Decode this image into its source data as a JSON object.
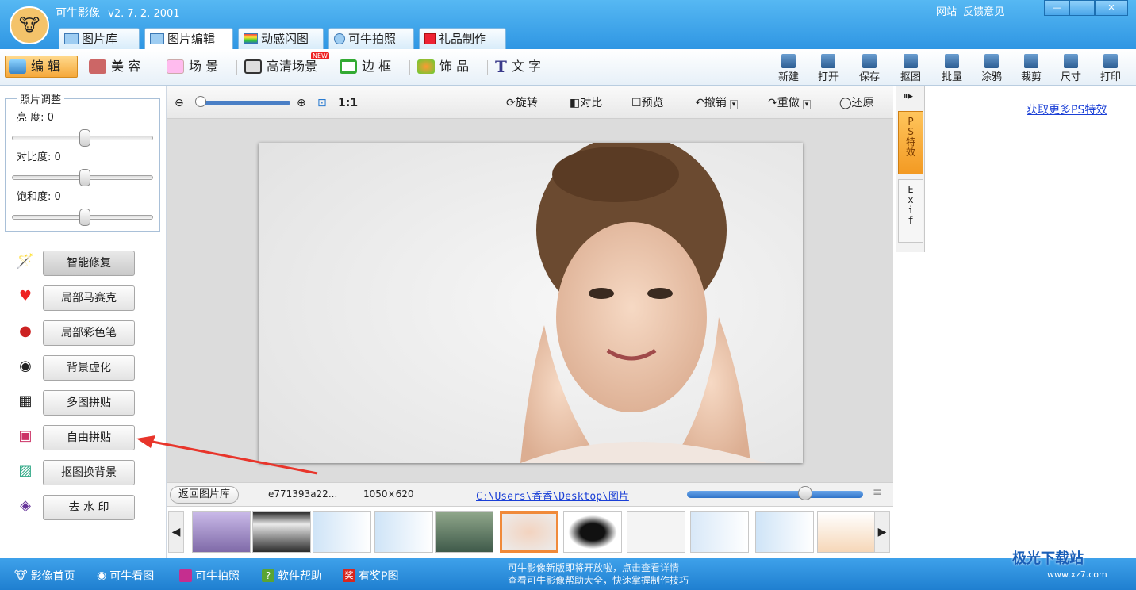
{
  "app": {
    "title": "可牛影像",
    "version": "v2. 7. 2. 2001"
  },
  "top_links": {
    "website": "网站",
    "feedback": "反馈意见"
  },
  "window_controls": [
    "—",
    "▫",
    "✕"
  ],
  "main_tabs": [
    "图片库",
    "图片编辑",
    "动感闪图",
    "可牛拍照",
    "礼品制作"
  ],
  "edit_tabs": [
    "编 辑",
    "美 容",
    "场 景",
    "高清场景",
    "边 框",
    "饰 品",
    "文 字"
  ],
  "new_badge": "NEW",
  "right_tools": [
    "新建",
    "打开",
    "保存",
    "抠图",
    "批量",
    "涂鸦",
    "裁剪",
    "尺寸",
    "打印"
  ],
  "adjust": {
    "legend": "照片调整",
    "items": [
      {
        "label": "亮  度: 0",
        "value": 0
      },
      {
        "label": "对比度: 0",
        "value": 0
      },
      {
        "label": "饱和度: 0",
        "value": 0
      }
    ]
  },
  "feature_buttons": [
    "智能修复",
    "局部马赛克",
    "局部彩色笔",
    "背景虚化",
    "多图拼贴",
    "自由拼贴",
    "抠图换背景",
    "去 水 印"
  ],
  "canvas_toolbar": {
    "zoom_ratio": "1:1",
    "rotate": "旋转",
    "compare": "对比",
    "preview": "预览",
    "undo": "撤销",
    "redo": "重做",
    "restore": "还原"
  },
  "info": {
    "back_label": "返回图片库",
    "filename": "e771393a22...",
    "dimensions": "1050×620",
    "path": "C:\\Users\\香香\\Desktop\\图片"
  },
  "side_tabs": [
    "P\nS\n特\n效",
    "E\nx\ni\nf"
  ],
  "right_link": "获取更多PS特效",
  "status": [
    "影像首页",
    "可牛看图",
    "可牛拍照",
    "软件帮助",
    "有奖P图"
  ],
  "status_scroll": [
    "可牛影像新版即将开放啦，点击查看详情",
    "查看可牛影像帮助大全，快速掌握制作技巧"
  ],
  "watermark": {
    "brand": "极光下载站",
    "url": "www.xz7.com"
  },
  "colors": {
    "titlebar": "#3fa6ee",
    "accent_orange": "#f5a83a",
    "link": "#1a3fd6"
  }
}
